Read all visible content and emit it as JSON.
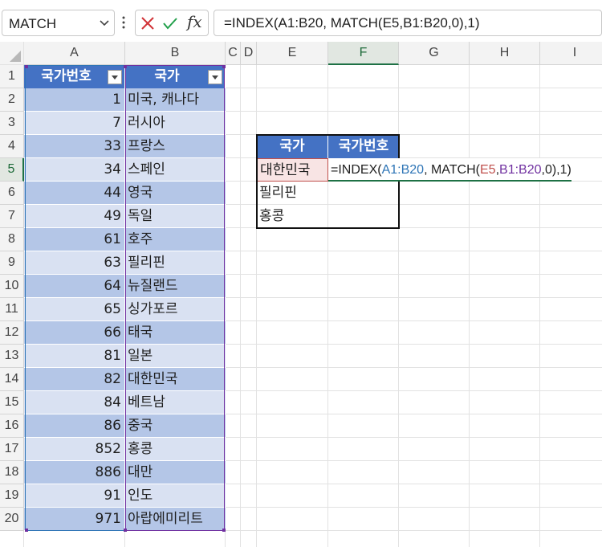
{
  "formula_bar": {
    "name_box": "MATCH",
    "formula": "=INDEX(A1:B20, MATCH(E5,B1:B20,0),1)",
    "fx_label": "fx"
  },
  "columns": [
    "A",
    "B",
    "C",
    "D",
    "E",
    "F",
    "G",
    "H",
    "I"
  ],
  "rows": [
    "1",
    "2",
    "3",
    "4",
    "5",
    "6",
    "7",
    "8",
    "9",
    "10",
    "11",
    "12",
    "13",
    "14",
    "15",
    "16",
    "17",
    "18",
    "19",
    "20"
  ],
  "table": {
    "headers": [
      "국가번호",
      "국가"
    ],
    "rows": [
      {
        "code": "1",
        "country": "미국, 캐나다"
      },
      {
        "code": "7",
        "country": "러시아"
      },
      {
        "code": "33",
        "country": "프랑스"
      },
      {
        "code": "34",
        "country": "스페인"
      },
      {
        "code": "44",
        "country": "영국"
      },
      {
        "code": "49",
        "country": "독일"
      },
      {
        "code": "61",
        "country": "호주"
      },
      {
        "code": "63",
        "country": "필리핀"
      },
      {
        "code": "64",
        "country": "뉴질랜드"
      },
      {
        "code": "65",
        "country": "싱가포르"
      },
      {
        "code": "66",
        "country": "태국"
      },
      {
        "code": "81",
        "country": "일본"
      },
      {
        "code": "82",
        "country": "대한민국"
      },
      {
        "code": "84",
        "country": "베트남"
      },
      {
        "code": "86",
        "country": "중국"
      },
      {
        "code": "852",
        "country": "홍콩"
      },
      {
        "code": "886",
        "country": "대만"
      },
      {
        "code": "91",
        "country": "인도"
      },
      {
        "code": "971",
        "country": "아랍에미리트"
      }
    ]
  },
  "lookup": {
    "headers": [
      "국가",
      "국가번호"
    ],
    "countries": [
      "대한민국",
      "필리핀",
      "홍콩"
    ],
    "editing_cell": "=INDEX(A1:B20, MATCH(E5,B1:B20,0),1)"
  },
  "colors": {
    "header_blue": "#4472c4",
    "band_dark": "#b4c6e7",
    "band_light": "#d9e1f2",
    "ref_blue": "#2e75b6",
    "ref_red": "#c0504d",
    "ref_purple": "#7030a0",
    "excel_green": "#1e7145"
  }
}
